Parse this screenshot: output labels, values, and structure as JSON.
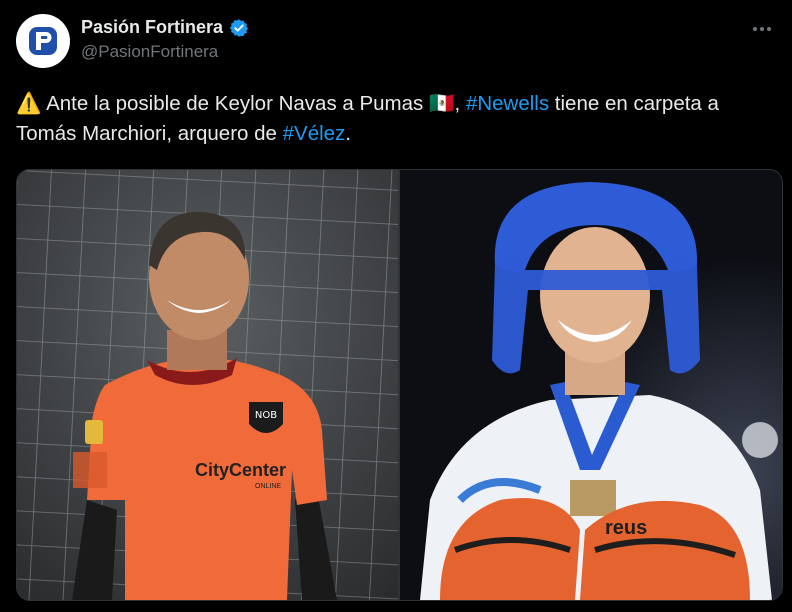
{
  "author": {
    "display_name": "Pasión Fortinera",
    "handle": "@PasionFortinera",
    "verified": true,
    "avatar_letter": "P",
    "avatar_color": "#1f4fa8"
  },
  "tweet": {
    "warning_emoji": "⚠️",
    "text_1": "Ante la posible de Keylor Navas a Pumas",
    "flag_emoji": "🇲🇽",
    "text_2": ", ",
    "hashtag_1": "#Newells",
    "text_3": " tiene en carpeta a Tomás Marchiori, arquero de ",
    "hashtag_2": "#Vélez",
    "text_4": "."
  },
  "media": {
    "left_photo": {
      "jersey_badge": "NOB",
      "sponsor": "CityCenter",
      "sponsor_sub": "ONLINE"
    },
    "right_photo": {
      "glove_brand": "reus"
    }
  },
  "colors": {
    "background": "#000000",
    "text": "#e7e9ea",
    "muted": "#71767b",
    "link": "#1d9bf0",
    "verified": "#1d9bf0"
  },
  "icons": [
    "more-icon",
    "verified-badge-icon",
    "warning-icon",
    "mexico-flag-icon"
  ]
}
